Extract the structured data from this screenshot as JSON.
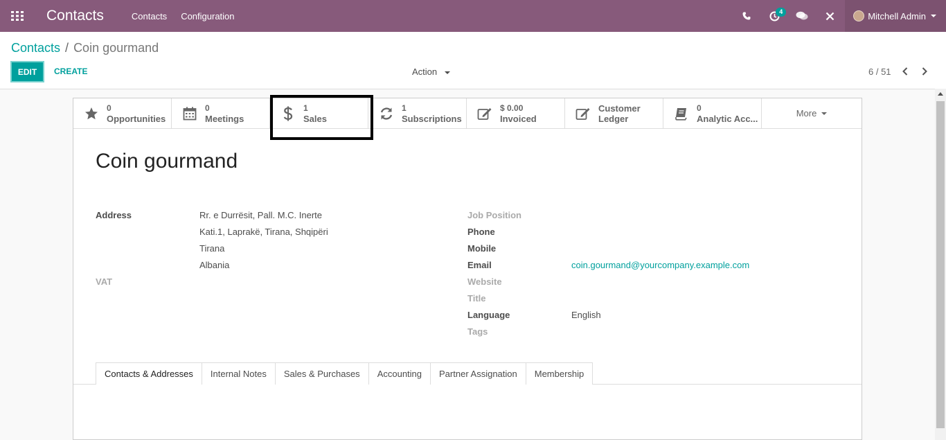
{
  "navbar": {
    "app_title": "Contacts",
    "menu": [
      "Contacts",
      "Configuration"
    ],
    "activity_count": "4",
    "user_name": "Mitchell Admin",
    "bg_color": "#875a7b"
  },
  "breadcrumb": {
    "parent": "Contacts",
    "separator": "/",
    "current": "Coin gourmand"
  },
  "toolbar": {
    "edit_label": "EDIT",
    "create_label": "CREATE",
    "action_label": "Action",
    "pager": "6 / 51"
  },
  "smart_buttons": [
    {
      "icon": "star-icon",
      "value": "0",
      "label": "Opportunities"
    },
    {
      "icon": "calendar-icon",
      "value": "0",
      "label": "Meetings"
    },
    {
      "icon": "dollar-icon",
      "value": "1",
      "label": "Sales"
    },
    {
      "icon": "refresh-icon",
      "value": "1",
      "label": "Subscriptions"
    },
    {
      "icon": "pencil-square-icon",
      "value": "$ 0.00",
      "label": "Invoiced"
    },
    {
      "icon": "pencil-square-icon",
      "value": "Customer",
      "label": "Ledger"
    },
    {
      "icon": "book-icon",
      "value": "0",
      "label": "Analytic Acc..."
    }
  ],
  "more_label": "More",
  "record": {
    "name": "Coin gourmand",
    "address_label": "Address",
    "address_lines": [
      "Rr. e Durrësit, Pall. M.C. Inerte",
      "Kati.1, Laprakë, Tirana, Shqipëri",
      "Tirana",
      "Albania"
    ],
    "vat_label": "VAT",
    "job_position_label": "Job Position",
    "phone_label": "Phone",
    "mobile_label": "Mobile",
    "email_label": "Email",
    "email_value": "coin.gourmand@yourcompany.example.com",
    "website_label": "Website",
    "title_label": "Title",
    "language_label": "Language",
    "language_value": "English",
    "tags_label": "Tags"
  },
  "tabs": [
    "Contacts & Addresses",
    "Internal Notes",
    "Sales & Purchases",
    "Accounting",
    "Partner Assignation",
    "Membership"
  ]
}
